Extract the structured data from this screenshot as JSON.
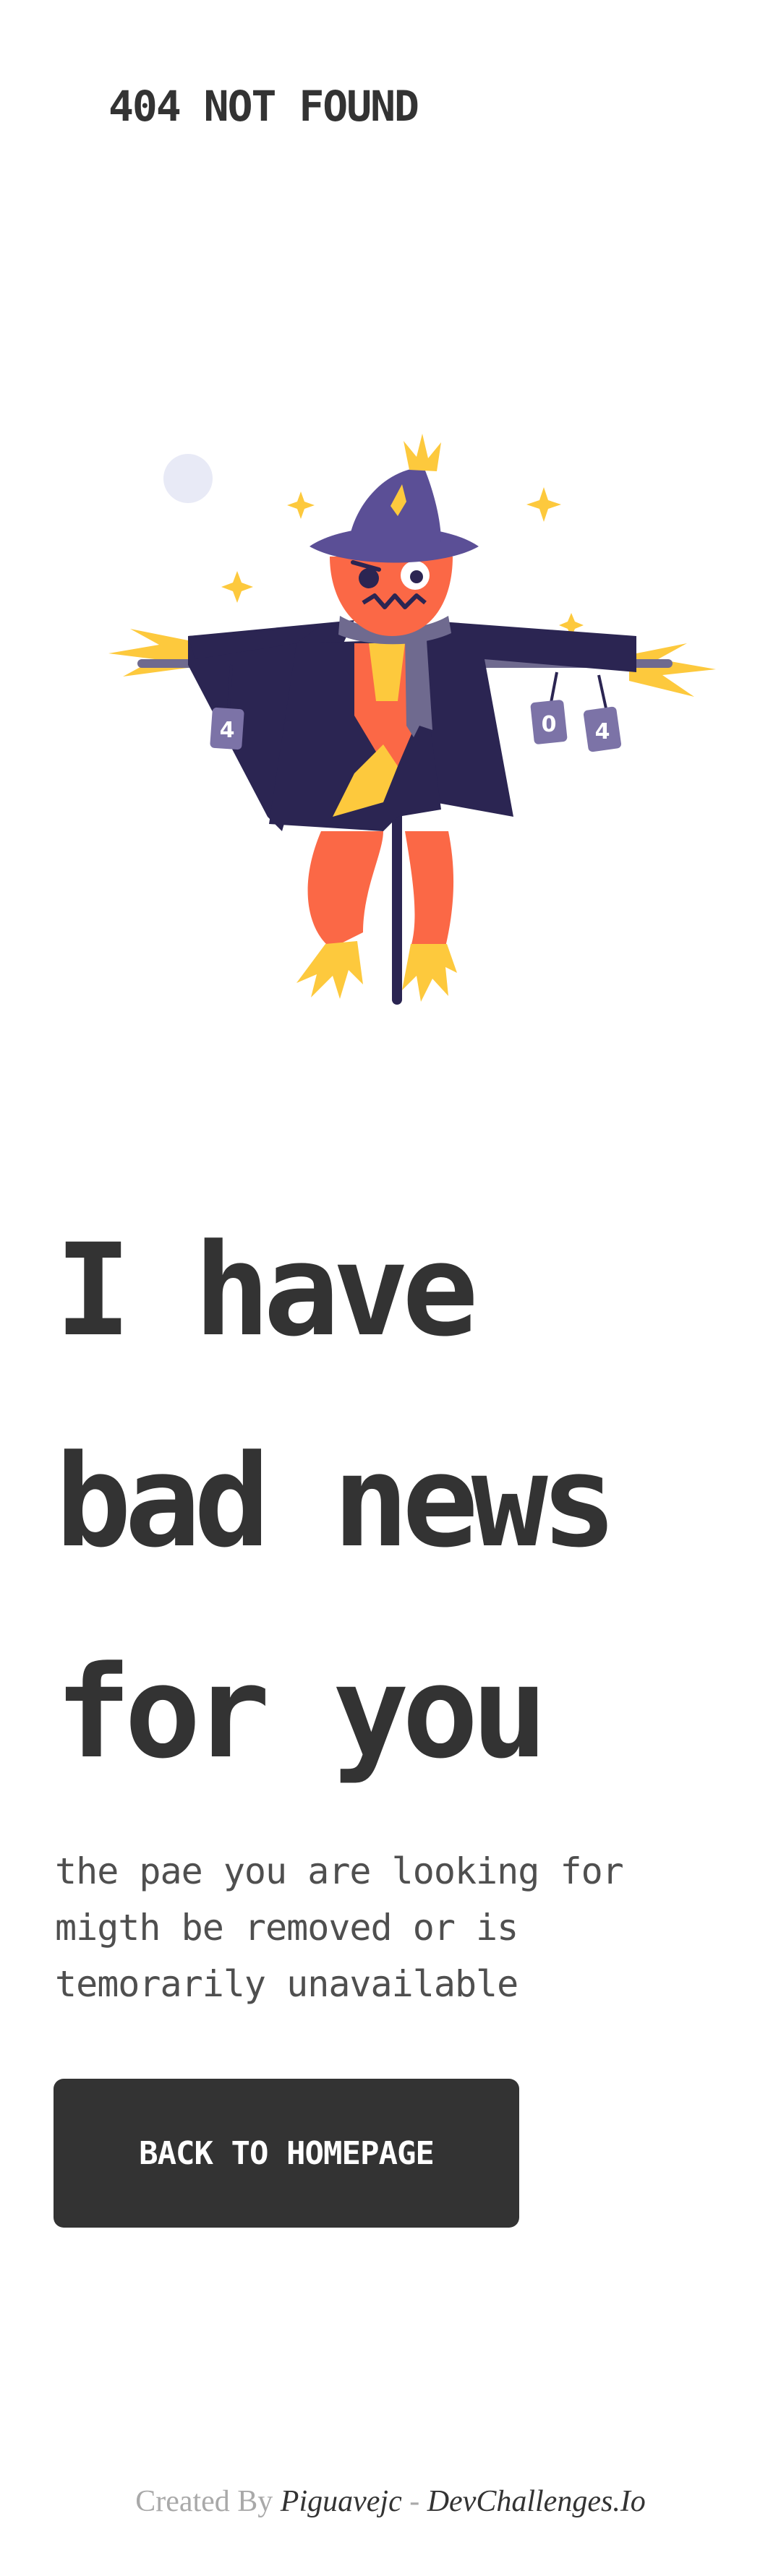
{
  "header": {
    "title": "404 NOT FOUND"
  },
  "illustration": {
    "icon": "scarecrow-illustration",
    "can_labels": [
      "4",
      "0",
      "4"
    ],
    "colors": {
      "dark": "#2b2552",
      "hat": "#5b4f96",
      "skin": "#fb6846",
      "straw": "#fdc93d",
      "scarf": "#6f6a8f",
      "can": "#7c73a7",
      "moon": "#e8eaf6"
    }
  },
  "main": {
    "headline": [
      "I have",
      "bad news",
      "for you"
    ],
    "subtext": [
      "the pae you are looking for",
      "migth be removed or is",
      "temorarily unavailable"
    ],
    "button_label": "BACK TO HOMEPAGE"
  },
  "footer": {
    "prefix": "Created By ",
    "author": "Piguavejc",
    "separator": " - ",
    "site": "DevChallenges.Io"
  },
  "colors": {
    "text": "#333333",
    "button_bg": "#333333",
    "button_text": "#ffffff",
    "muted": "#a9a9a9"
  }
}
